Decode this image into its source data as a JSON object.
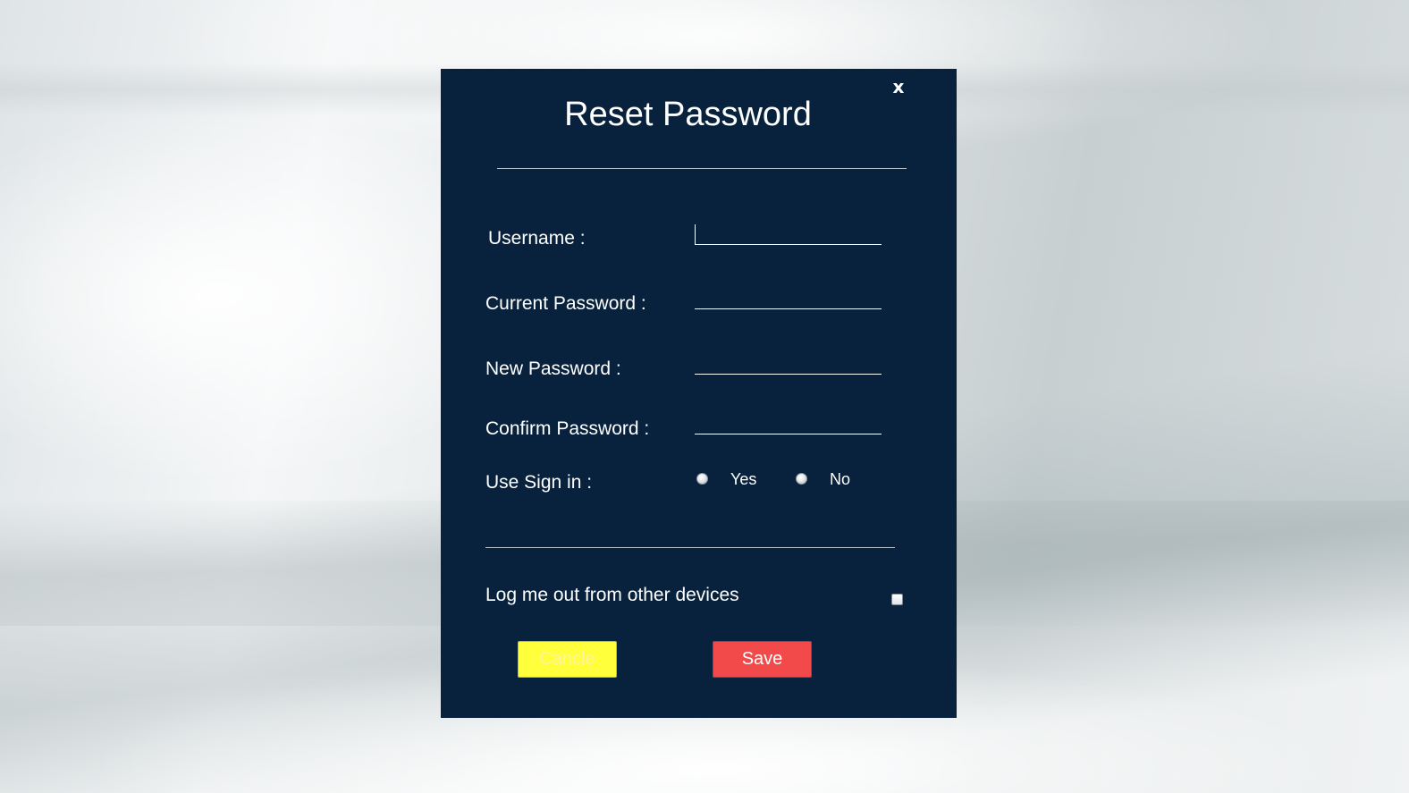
{
  "dialog": {
    "title": "Reset Password",
    "close_label": "x"
  },
  "form": {
    "username": {
      "label": "Username :",
      "value": "",
      "placeholder": ""
    },
    "current_password": {
      "label": "Current Password :",
      "value": "",
      "placeholder": ""
    },
    "new_password": {
      "label": "New Password :",
      "value": "",
      "placeholder": ""
    },
    "confirm_password": {
      "label": "Confirm Password :",
      "value": "",
      "placeholder": ""
    },
    "use_sign_in": {
      "label": "Use Sign in :",
      "options": [
        "Yes",
        "No"
      ],
      "selected": null
    },
    "logout_other_devices": {
      "label": "Log me out from other devices",
      "checked": false
    }
  },
  "buttons": {
    "cancel_label": "Cancle",
    "save_label": "Save"
  },
  "colors": {
    "dialog_bg": "#08223d",
    "cancel_bg": "#ffff3b",
    "save_bg": "#f24a4a",
    "text": "#ffffff"
  }
}
